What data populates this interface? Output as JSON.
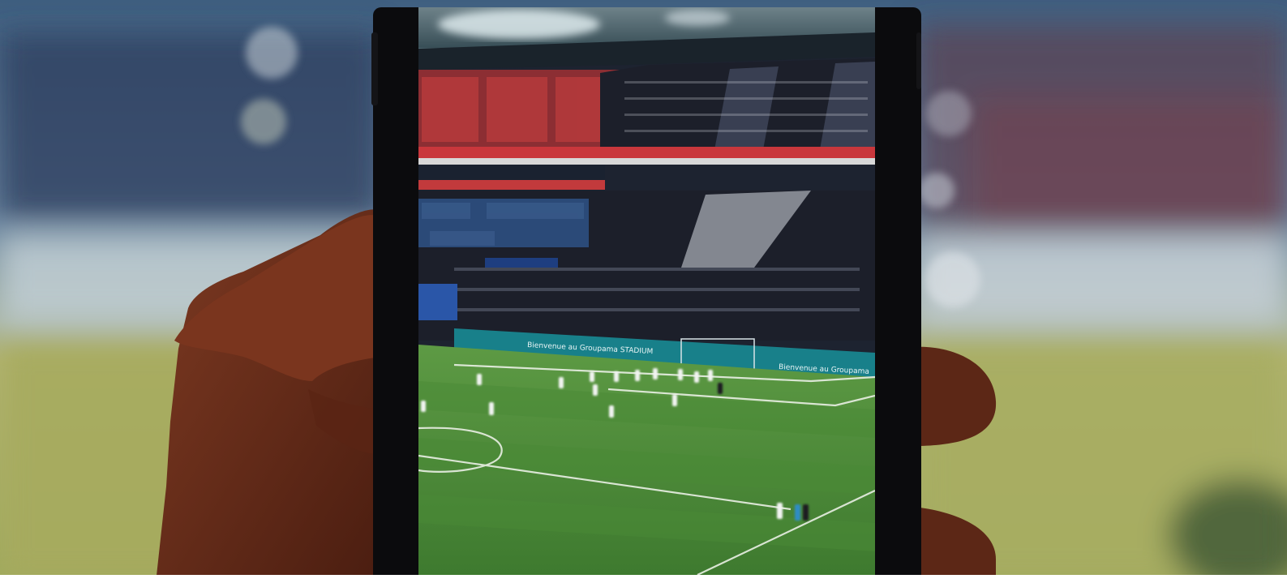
{
  "image": {
    "description_icon": "photo",
    "subject": "hand holding smartphone filming football match in stadium"
  },
  "banners": {
    "upper_tier": "",
    "pitch_side_left": "Bienvenue au Groupama STADIUM",
    "pitch_side_right": "Bienvenue au Groupama"
  },
  "colors": {
    "pitch_green": "#4f8a3a",
    "crowd_dark": "#1c1f2a",
    "seat_red": "#b63a3c",
    "seat_blue": "#2b4a78",
    "phone_black": "#0b0b0d",
    "skin": "#6b2e1a",
    "bokeh_blue": "#5a7898",
    "bokeh_yellow": "#b7b56e"
  }
}
